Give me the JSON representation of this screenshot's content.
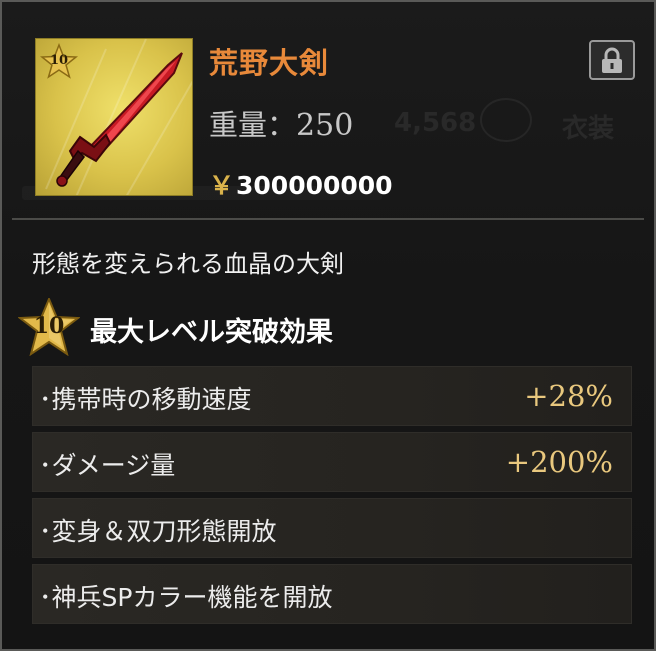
{
  "item": {
    "name": "荒野大剣",
    "weight_label": "重量：",
    "weight_value": "250",
    "currency_symbol": "￥",
    "price": "300000000",
    "star_level": "10",
    "description": "形態を変えられる血晶の大剣"
  },
  "background": {
    "number": "4,568",
    "costume": "衣装"
  },
  "max_level": {
    "star_level": "10",
    "title": "最大レベル突破効果"
  },
  "effects": [
    {
      "label": "･携帯時の移動速度",
      "value": "+28%"
    },
    {
      "label": "･ダメージ量",
      "value": "+200%"
    },
    {
      "label": "･変身＆双刀形態開放",
      "value": ""
    },
    {
      "label": "･神兵SPカラー機能を開放",
      "value": ""
    }
  ],
  "colors": {
    "name": "#e8893a",
    "value": "#e9c87e",
    "icon_bg": "#d9c24a"
  }
}
